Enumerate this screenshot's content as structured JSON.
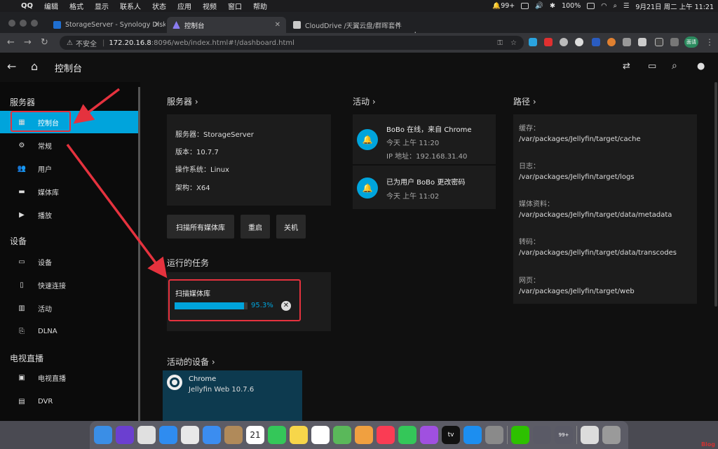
{
  "menubar": {
    "apple": "",
    "items": [
      "QQ",
      "编辑",
      "格式",
      "显示",
      "联系人",
      "状态",
      "应用",
      "视频",
      "窗口",
      "帮助"
    ],
    "right": {
      "notifications": "99+",
      "battery": "100%",
      "clock": "9月21日 周二 上午 11:21"
    }
  },
  "browser": {
    "tabs": [
      {
        "title": "StorageServer - Synology Disk",
        "favicon_color": "#1f6fd1"
      },
      {
        "title": "控制台",
        "favicon_color": "#8a7cf0"
      },
      {
        "title": "CloudDrive /天翼云盘/群晖套件",
        "favicon_color": "#c9c9c9"
      }
    ],
    "security": "不安全",
    "url_host": "172.20.16.8",
    "url_path": ":8096/web/index.html#!/dashboard.html",
    "profile": "面请"
  },
  "appbar": {
    "title": "控制台"
  },
  "sidebar": {
    "sections": [
      {
        "title": "服务器",
        "items": [
          {
            "label": "控制台",
            "icon": "dashboard-icon"
          },
          {
            "label": "常规",
            "icon": "gear-icon"
          },
          {
            "label": "用户",
            "icon": "people-icon"
          },
          {
            "label": "媒体库",
            "icon": "folder-icon"
          },
          {
            "label": "播放",
            "icon": "play-icon"
          }
        ]
      },
      {
        "title": "设备",
        "items": [
          {
            "label": "设备",
            "icon": "devices-icon"
          },
          {
            "label": "快速连接",
            "icon": "phone-link-icon"
          },
          {
            "label": "活动",
            "icon": "activity-chart-icon"
          },
          {
            "label": "DLNA",
            "icon": "dlna-icon"
          }
        ]
      },
      {
        "title": "电视直播",
        "items": [
          {
            "label": "电视直播",
            "icon": "live-tv-icon"
          },
          {
            "label": "DVR",
            "icon": "dvr-icon"
          }
        ]
      }
    ]
  },
  "server": {
    "heading": "服务器 ›",
    "fields": [
      {
        "label": "服务器：",
        "value": "StorageServer"
      },
      {
        "label": "版本：",
        "value": "10.7.7"
      },
      {
        "label": "操作系统：",
        "value": "Linux"
      },
      {
        "label": "架构：",
        "value": "X64"
      }
    ],
    "buttons": {
      "scan": "扫描所有媒体库",
      "restart": "重启",
      "shutdown": "关机"
    }
  },
  "tasks": {
    "heading": "运行的任务",
    "items": [
      {
        "name": "扫描媒体库",
        "progress": 0.953,
        "progress_text": "95.3%"
      }
    ]
  },
  "devices": {
    "heading": "活动的设备 ›",
    "items": [
      {
        "name": "Chrome",
        "client": "Jellyfin Web 10.7.6"
      }
    ]
  },
  "activity": {
    "heading": "活动 ›",
    "items": [
      {
        "title": "BoBo 在线，来自 Chrome",
        "time": "今天 上午 11:20",
        "detail": "IP 地址：192.168.31.40"
      },
      {
        "title": "已为用户 BoBo 更改密码",
        "time": "今天 上午 11:02",
        "detail": ""
      }
    ]
  },
  "paths": {
    "heading": "路径 ›",
    "items": [
      {
        "label": "缓存：",
        "value": "/var/packages/Jellyfin/target/cache"
      },
      {
        "label": "日志：",
        "value": "/var/packages/Jellyfin/target/logs"
      },
      {
        "label": "媒体资料：",
        "value": "/var/packages/Jellyfin/target/data/metadata"
      },
      {
        "label": "转码：",
        "value": "/var/packages/Jellyfin/target/data/transcodes"
      },
      {
        "label": "网页：",
        "value": "/var/packages/Jellyfin/target/web"
      }
    ]
  },
  "dock": {
    "apps": [
      {
        "name": "Finder",
        "color": "#3a8ee6"
      },
      {
        "name": "Siri",
        "color": "#6b3fd0"
      },
      {
        "name": "Launchpad",
        "color": "#e0e0e0"
      },
      {
        "name": "Safari",
        "color": "#2f8cf0"
      },
      {
        "name": "Chrome",
        "color": "#e8e8e8"
      },
      {
        "name": "Mail",
        "color": "#3b8df0"
      },
      {
        "name": "Contacts",
        "color": "#b08a5a"
      },
      {
        "name": "Calendar",
        "color": "#ffffff"
      },
      {
        "name": "Messages",
        "color": "#34c759"
      },
      {
        "name": "Notes",
        "color": "#f7d64a"
      },
      {
        "name": "Reminders",
        "color": "#ffffff"
      },
      {
        "name": "Maps",
        "color": "#5ab85a"
      },
      {
        "name": "Photos",
        "color": "#f0a040"
      },
      {
        "name": "Music",
        "color": "#fa3c54"
      },
      {
        "name": "FaceTime",
        "color": "#34c759"
      },
      {
        "name": "Podcasts",
        "color": "#a050e0"
      },
      {
        "name": "TV",
        "color": "#111111"
      },
      {
        "name": "App Store",
        "color": "#1c8ef0"
      },
      {
        "name": "System Preferences",
        "color": "#8a8a8a"
      },
      {
        "name": "WeChat",
        "color": "#2dc100"
      },
      {
        "name": "Workflow",
        "color": "#5a5a66"
      },
      {
        "name": "QQ",
        "color": "#5a5a66"
      },
      {
        "name": "Preview",
        "color": "#dcdcdc"
      },
      {
        "name": "Trash",
        "color": "#9a9a9a"
      }
    ],
    "calendar_day": "21",
    "qq_badge": "99+",
    "tv_label": "tv"
  },
  "colors": {
    "accent": "#00a4dc",
    "annotation": "#e5323e"
  }
}
